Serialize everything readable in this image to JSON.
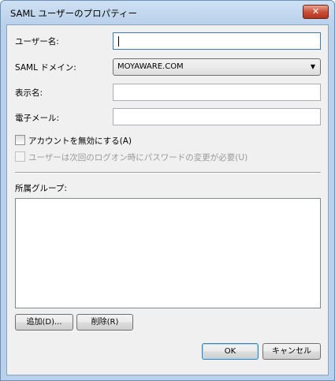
{
  "window": {
    "title": "SAML ユーザーのプロパティー",
    "close_symbol": "✕"
  },
  "form": {
    "username_label": "ユーザー名:",
    "username_value": "",
    "domain_label": "SAML ドメイン:",
    "domain_value": "MOYAWARE.COM",
    "domain_arrow": "▼",
    "display_name_label": "表示名:",
    "display_name_value": "",
    "email_label": "電子メール:",
    "email_value": ""
  },
  "options": {
    "disable_account_label": "アカウントを無効にする(A)",
    "disable_account_checked": false,
    "must_change_password_label": "ユーザーは次回のログオン時にパスワードの変更が必要(U)",
    "must_change_password_checked": false,
    "must_change_password_enabled": false
  },
  "groups": {
    "label": "所属グループ:",
    "items": []
  },
  "buttons": {
    "add": "追加(D)...",
    "remove": "削除(R)",
    "ok": "OK",
    "cancel": "キャンセル"
  },
  "icons": {
    "close": "close-icon",
    "dropdown": "chevron-down-icon"
  }
}
